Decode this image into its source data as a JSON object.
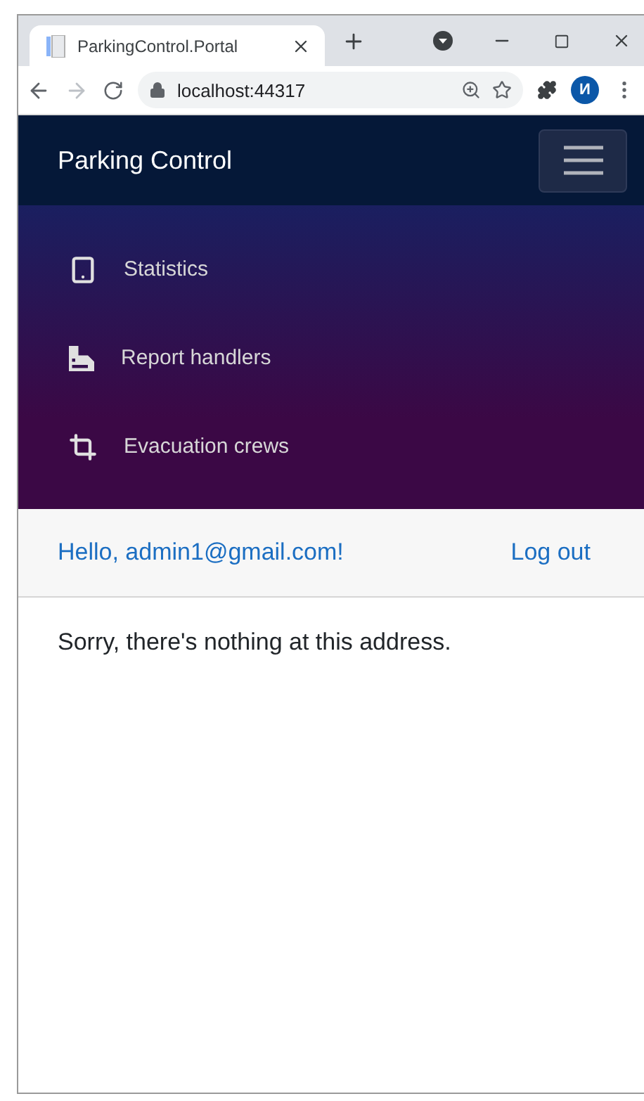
{
  "browser": {
    "tab_title": "ParkingControl.Portal",
    "address": "localhost:44317",
    "profile_initial": "И"
  },
  "navbar": {
    "brand": "Parking Control"
  },
  "menu": [
    {
      "label": "Statistics"
    },
    {
      "label": "Report handlers"
    },
    {
      "label": "Evacuation crews"
    }
  ],
  "user_bar": {
    "greeting": "Hello, admin1@gmail.com!",
    "logout": "Log out"
  },
  "content": {
    "message": "Sorry, there's nothing at this address."
  }
}
